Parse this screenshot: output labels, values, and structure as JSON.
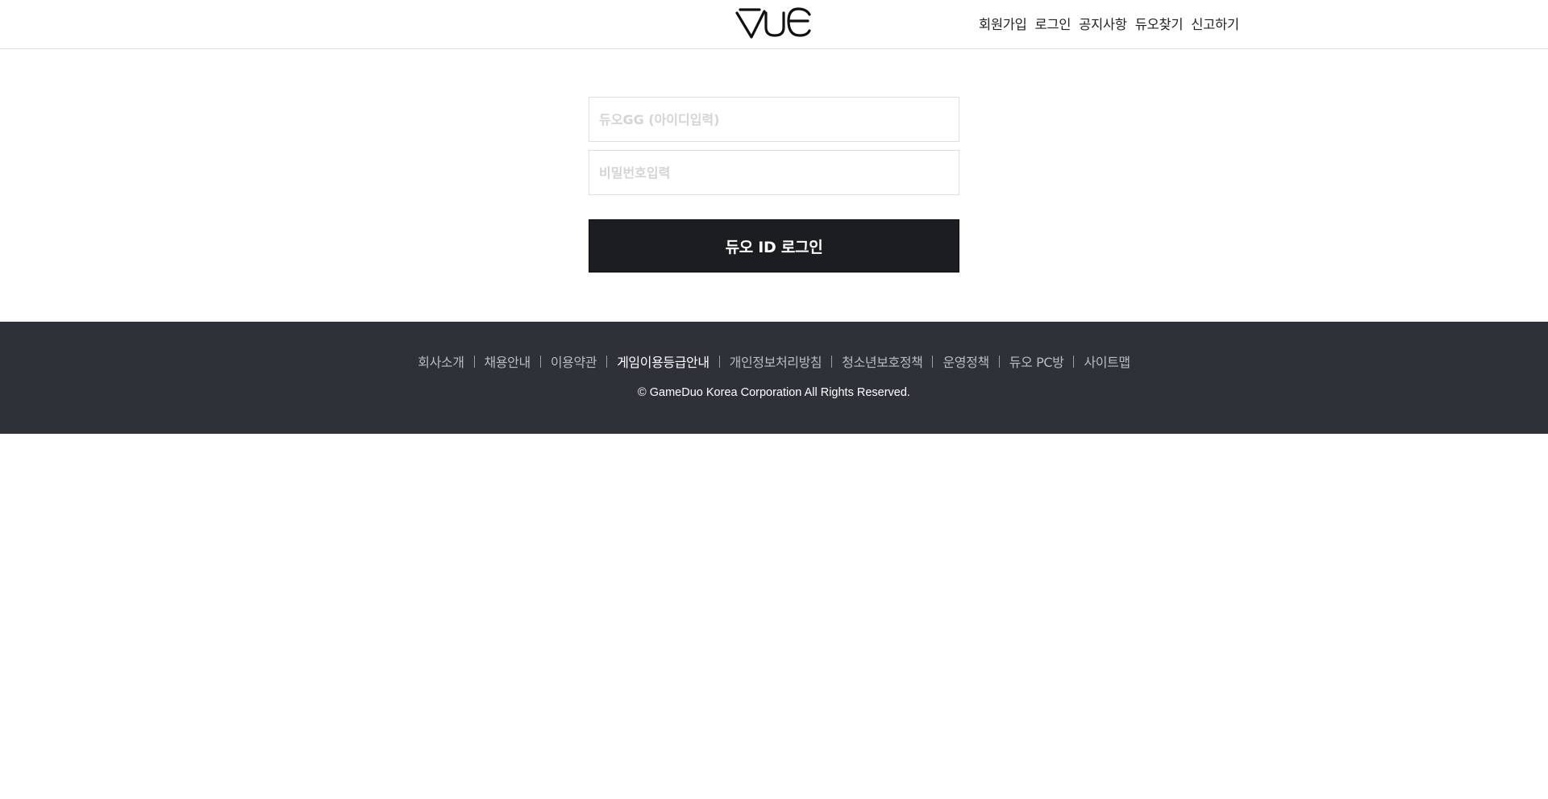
{
  "header": {
    "logo_text": "VUE",
    "nav": [
      {
        "label": "회원가입"
      },
      {
        "label": "로그인"
      },
      {
        "label": "공지사항"
      },
      {
        "label": "듀오찾기"
      },
      {
        "label": "신고하기"
      }
    ]
  },
  "login": {
    "id_value": "",
    "id_placeholder": "듀오GG (아이디입력)",
    "password_value": "",
    "password_placeholder": "비밀번호입력",
    "button_label": "듀오 ID 로그인"
  },
  "footer": {
    "links": [
      {
        "label": "회사소개"
      },
      {
        "label": "채용안내"
      },
      {
        "label": "이용약관"
      },
      {
        "label": "게임이용등급안내"
      },
      {
        "label": "개인정보처리방침"
      },
      {
        "label": "청소년보호정책"
      },
      {
        "label": "운영정책"
      },
      {
        "label": "듀오 PC방"
      },
      {
        "label": "사이트맵"
      }
    ],
    "copyright": "© GameDuo Korea Corporation All Rights Reserved."
  },
  "colors": {
    "footer_bg": "#2e3138",
    "button_bg": "#1c1d20",
    "highlight_link": "#ffffff"
  }
}
